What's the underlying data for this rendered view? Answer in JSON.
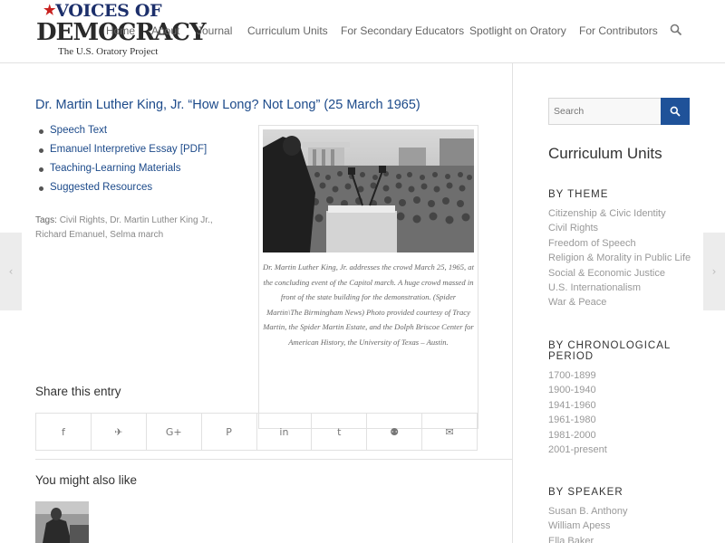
{
  "logo": {
    "line1": "VOICES OF",
    "line2": "DEMOCRACY",
    "line3": "The U.S. Oratory Project"
  },
  "nav": {
    "items": [
      {
        "label": "Home"
      },
      {
        "label": "About"
      },
      {
        "label": "Journal"
      },
      {
        "label": "Curriculum Units"
      },
      {
        "label": "For Secondary Educators"
      },
      {
        "label": "Spotlight on Oratory"
      },
      {
        "label": "For Contributors"
      }
    ],
    "search_icon": "search-icon"
  },
  "post": {
    "title": "Dr. Martin Luther King, Jr. “How Long? Not Long” (25 March 1965)",
    "links": [
      {
        "label": "Speech Text"
      },
      {
        "label": "Emanuel Interpretive Essay [PDF]"
      },
      {
        "label": "Teaching-Learning Materials"
      },
      {
        "label": "Suggested Resources"
      }
    ],
    "tags_label": "Tags:",
    "tags": [
      "Civil Rights",
      "Dr. Martin Luther King Jr.",
      "Richard Emanuel",
      "Selma march"
    ],
    "caption": "Dr. Martin Luther King, Jr. addresses the crowd March 25, 1965, at the concluding event of the Capitol march. A huge crowd massed in front of the state building for the demonstration. (Spider Martin\\The Birmingham News) Photo provided courtesy of Tracy Martin, the Spider Martin Estate, and the Dolph Briscoe Center for American History, the University of Texas – Austin."
  },
  "share": {
    "title": "Share this entry",
    "buttons": [
      {
        "icon": "facebook-icon",
        "glyph": "f"
      },
      {
        "icon": "twitter-icon",
        "glyph": "✈"
      },
      {
        "icon": "google-plus-icon",
        "glyph": "G+"
      },
      {
        "icon": "pinterest-icon",
        "glyph": "P"
      },
      {
        "icon": "linkedin-icon",
        "glyph": "in"
      },
      {
        "icon": "tumblr-icon",
        "glyph": "t"
      },
      {
        "icon": "reddit-icon",
        "glyph": "⚉"
      },
      {
        "icon": "mail-icon",
        "glyph": "✉"
      }
    ]
  },
  "related": {
    "title": "You might also like"
  },
  "sidebar": {
    "search_placeholder": "Search",
    "title": "Curriculum Units",
    "by_theme": {
      "heading": "BY THEME",
      "items": [
        "Citizenship & Civic Identity",
        "Civil Rights",
        "Freedom of Speech",
        "Religion & Morality in Public Life",
        "Social & Economic Justice",
        "U.S. Internationalism",
        "War & Peace"
      ]
    },
    "by_period": {
      "heading": "BY CHRONOLOGICAL PERIOD",
      "items": [
        "1700-1899",
        "1900-1940",
        "1941-1960",
        "1961-1980",
        "1981-2000",
        "2001-present"
      ]
    },
    "by_speaker": {
      "heading": "BY SPEAKER",
      "items": [
        "Susan B. Anthony",
        "William Apess",
        "Ella Baker"
      ]
    }
  },
  "colors": {
    "link": "#1c4a8a",
    "accent": "#1f5299",
    "border": "#e1e1e1"
  }
}
